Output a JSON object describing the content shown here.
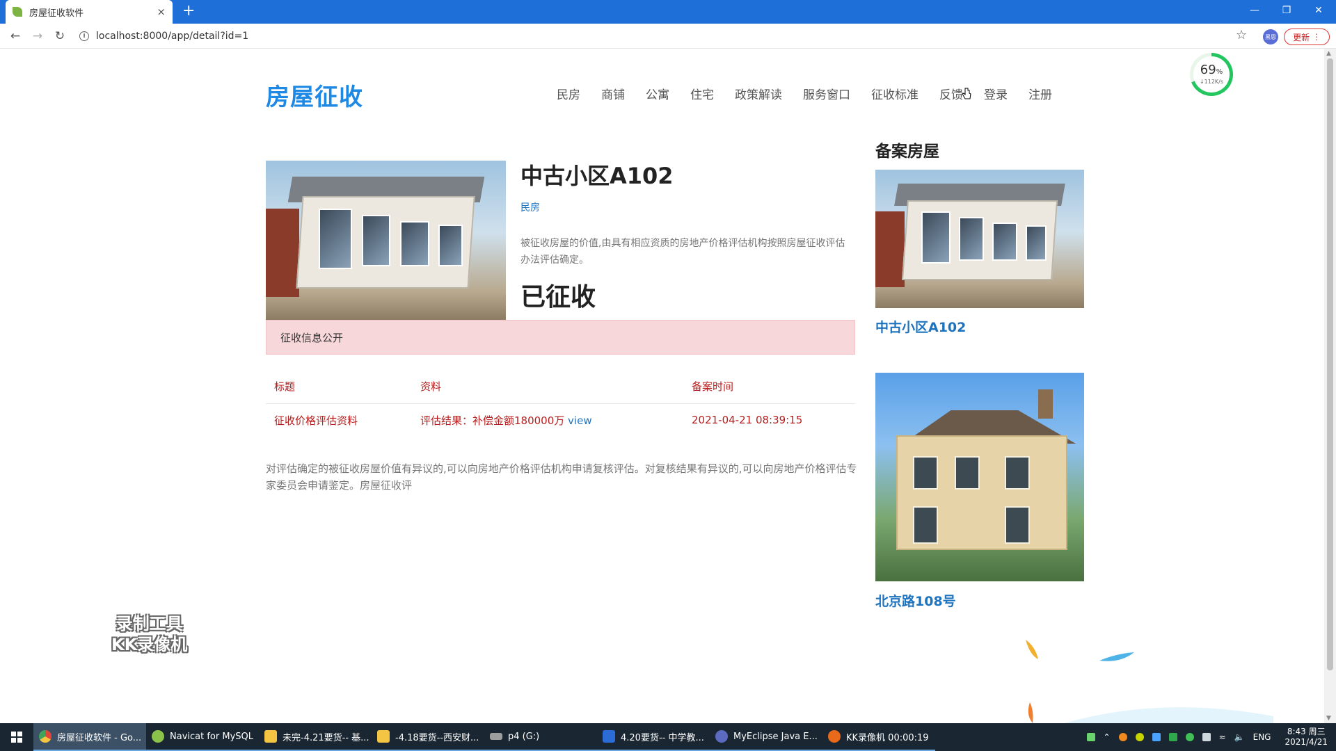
{
  "browser": {
    "tab_title": "房屋征收软件",
    "tab_close": "×",
    "new_tab": "+",
    "url": "localhost:8000/app/detail?id=1",
    "update_label": "更新",
    "profile_label": "黑恩"
  },
  "site": {
    "logo": "房屋征收",
    "nav": [
      "民房",
      "商铺",
      "公寓",
      "住宅",
      "政策解读",
      "服务窗口",
      "征收标准",
      "反馈",
      "登录",
      "注册"
    ]
  },
  "speed_widget": {
    "percent": "69",
    "unit": "%",
    "rate": "↓112K/s"
  },
  "detail": {
    "title": "中古小区A102",
    "category": "民房",
    "description": "被征收房屋的价值,由具有相应资质的房地产价格评估机构按照房屋征收评估办法评估确定。",
    "status": "已征收",
    "alert": "征收信息公开",
    "table": {
      "headers": [
        "标题",
        "资料",
        "备案时间"
      ],
      "rows": [
        {
          "title": "征收价格评估资料",
          "info": "评估结果：补偿金额180000万",
          "link": "view",
          "time": "2021-04-21 08:39:15"
        }
      ]
    },
    "note": "对评估确定的被征收房屋价值有异议的,可以向房地产价格评估机构申请复核评估。对复核结果有异议的,可以向房地产价格评估专家委员会申请鉴定。房屋征收评"
  },
  "sidebar": {
    "title": "备案房屋",
    "items": [
      {
        "name": "中古小区A102"
      },
      {
        "name": "北京路108号"
      }
    ]
  },
  "watermark": {
    "line1": "录制工具",
    "line2": "KK录像机"
  },
  "taskbar": {
    "items": [
      {
        "label": "房屋征收软件 - Go...",
        "color": "#e0463a"
      },
      {
        "label": "Navicat for MySQL",
        "color": "#8bc34a"
      },
      {
        "label": "未完-4.21要货-- 基...",
        "color": "#f4c542"
      },
      {
        "label": "-4.18要货--西安财...",
        "color": "#f4c542"
      },
      {
        "label": "p4 (G:)",
        "color": "#9e9e9e"
      },
      {
        "label": "4.20要货-- 中学教...",
        "color": "#2b6cd6"
      },
      {
        "label": "MyEclipse Java E...",
        "color": "#5c6bc0"
      },
      {
        "label": "KK录像机 00:00:19",
        "color": "#e86a1a"
      }
    ],
    "lang": "ENG",
    "time": "8:43 周三",
    "date": "2021/4/21"
  }
}
